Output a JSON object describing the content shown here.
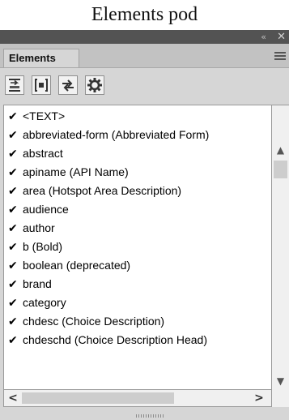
{
  "caption": "Elements pod",
  "panel": {
    "collapse_glyph": "«",
    "close_glyph": "✕",
    "tab_label": "Elements",
    "menu_icon": "hamburger-menu-icon"
  },
  "toolbar": {
    "buttons": [
      {
        "icon": "insert-element-icon"
      },
      {
        "icon": "wrap-element-icon"
      },
      {
        "icon": "change-element-icon"
      },
      {
        "icon": "settings-gear-icon"
      }
    ]
  },
  "elements": [
    {
      "check": "✔",
      "label": "<TEXT>"
    },
    {
      "check": "✔",
      "label": "abbreviated-form  (Abbreviated Form)"
    },
    {
      "check": "✔",
      "label": "abstract"
    },
    {
      "check": "✔",
      "label": "apiname  (API Name)"
    },
    {
      "check": "✔",
      "label": "area  (Hotspot Area Description)"
    },
    {
      "check": "✔",
      "label": "audience"
    },
    {
      "check": "✔",
      "label": "author"
    },
    {
      "check": "✔",
      "label": "b  (Bold)"
    },
    {
      "check": "✔",
      "label": "boolean  (deprecated)"
    },
    {
      "check": "✔",
      "label": "brand"
    },
    {
      "check": "✔",
      "label": "category"
    },
    {
      "check": "✔",
      "label": "chdesc  (Choice Description)"
    },
    {
      "check": "✔",
      "label": "chdeschd  (Choice Description Head)"
    }
  ],
  "scrollbars": {
    "up": "▲",
    "down": "▼",
    "left": "<",
    "right": ">"
  }
}
